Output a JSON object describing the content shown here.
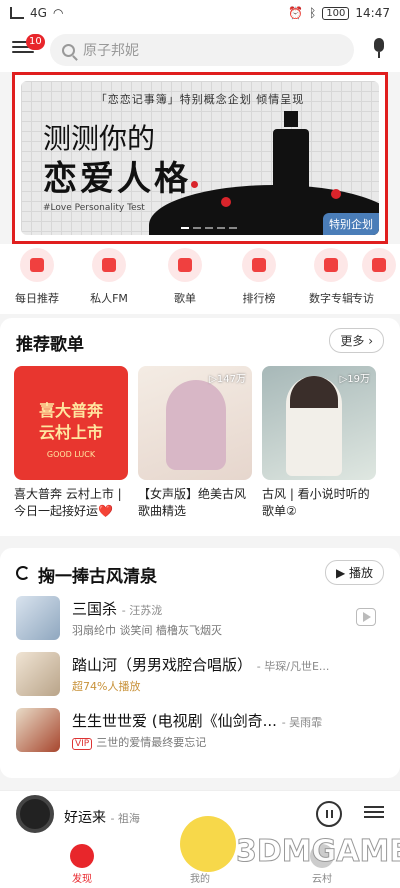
{
  "status": {
    "time": "14:47",
    "battery": "100",
    "net": "4G"
  },
  "header": {
    "badge": "10",
    "search_placeholder": "原子邦妮"
  },
  "banner": {
    "top_text": "「恋恋记事簿」特别概念企划   倾情呈现",
    "title_line1": "测测你的",
    "title_line2": "恋爱人格",
    "subtitle": "#Love Personality Test",
    "tag": "特别企划"
  },
  "quick_nav": [
    {
      "label": "每日推荐",
      "icon": "calendar-icon"
    },
    {
      "label": "私人FM",
      "icon": "radio-icon"
    },
    {
      "label": "歌单",
      "icon": "playlist-icon"
    },
    {
      "label": "排行榜",
      "icon": "chart-icon"
    },
    {
      "label": "数字专辑",
      "icon": "album-icon"
    },
    {
      "label": "专访",
      "icon": "mic-icon"
    }
  ],
  "playlists": {
    "title": "推荐歌单",
    "more": "更多",
    "items": [
      {
        "name": "喜大普奔 云村上市 | 今日一起接好运❤️",
        "cover_text": "喜大普奔\n云村上市",
        "cover_sub": "GOOD LUCK",
        "count": ""
      },
      {
        "name": "【女声版】绝美古风歌曲精选",
        "count": "▷147万"
      },
      {
        "name": "古风 | 看小说时听的歌单②",
        "count": "▷19万"
      }
    ]
  },
  "songs": {
    "title": "掬一捧古风清泉",
    "play_all": "▶ 播放",
    "items": [
      {
        "title": "三国杀",
        "artist": "- 汪苏泷",
        "sub": "羽扇纶巾 谈笑间 樯橹灰飞烟灭",
        "sub_style": "",
        "vip": false
      },
      {
        "title": "踏山河（男男戏腔合唱版）",
        "artist": "- 毕琛/凡世E...",
        "sub": "超74%人播放",
        "sub_style": "gold",
        "vip": false
      },
      {
        "title": "生生世世爱 (电视剧《仙剑奇...",
        "artist": "- 吴雨霏",
        "sub": "三世的爱情最终要忘记",
        "sub_style": "",
        "vip": true
      }
    ]
  },
  "player": {
    "now_playing": "好运来",
    "artist": "- 祖海"
  },
  "tabs": [
    {
      "label": "发现",
      "active": true
    },
    {
      "label": "我的",
      "active": false
    },
    {
      "label": "云村",
      "active": false
    }
  ],
  "watermark": "3DMGAME",
  "colors": {
    "accent": "#e8262b",
    "banner_border": "#e01e1e",
    "tag_blue": "#4a7db8"
  }
}
